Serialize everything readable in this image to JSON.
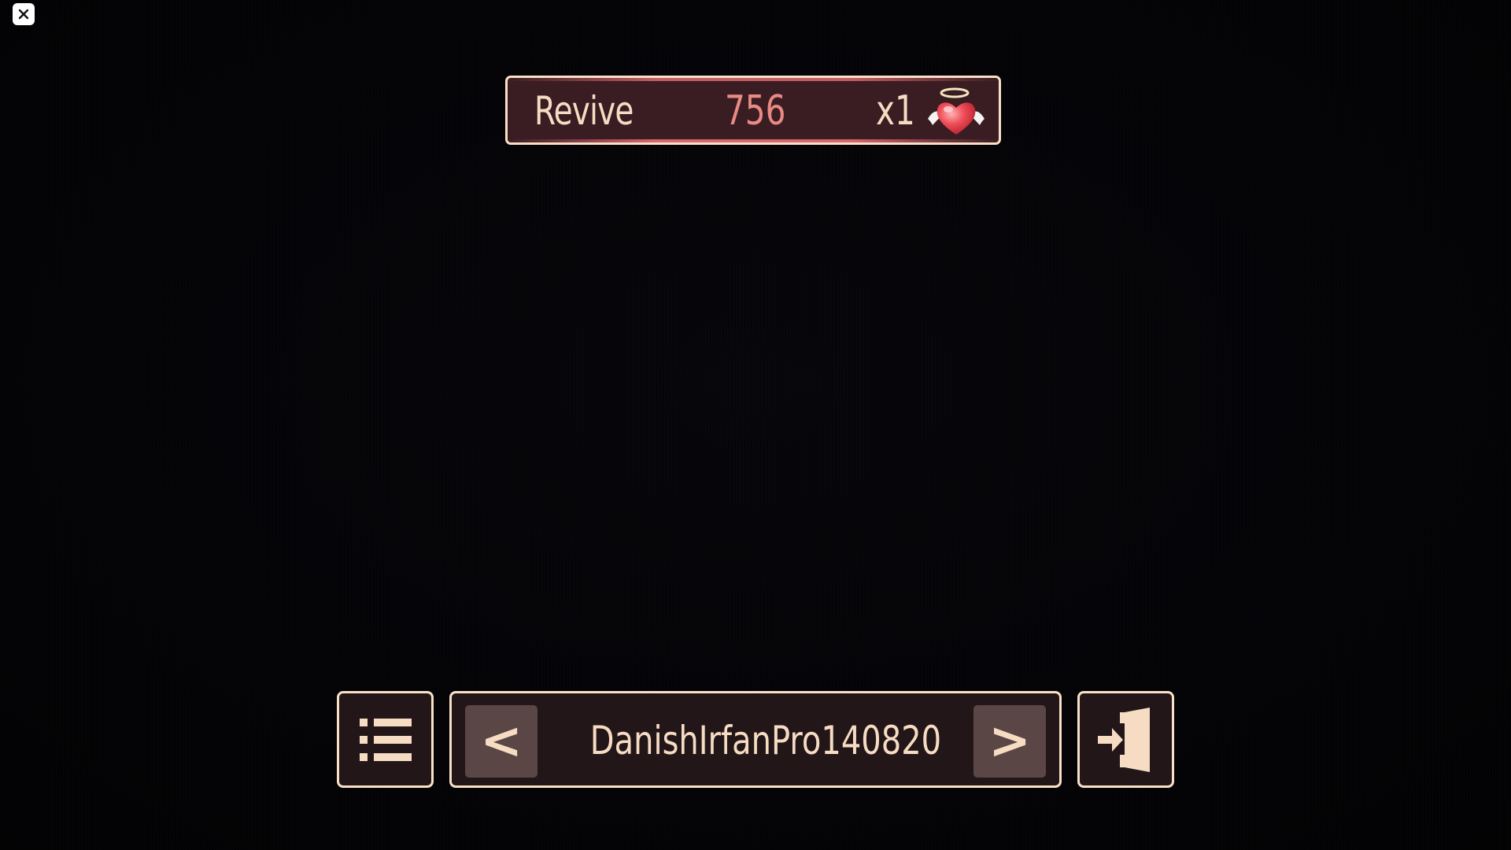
{
  "close": {
    "icon": "close-icon"
  },
  "revive": {
    "label": "Revive",
    "cost": "756",
    "count": "x1",
    "icon": "winged-heart-halo-icon"
  },
  "bottom_bar": {
    "menu_icon": "list-icon",
    "prev_label": "<",
    "player_name": "DanishIrfanPro140820",
    "next_label": ">",
    "exit_icon": "exit-door-icon"
  },
  "colors": {
    "border": "#f8e1c6",
    "panel": "#231618",
    "banner": "#3a1d22",
    "accent": "#e98a84",
    "arrow_button": "#5a4645"
  }
}
